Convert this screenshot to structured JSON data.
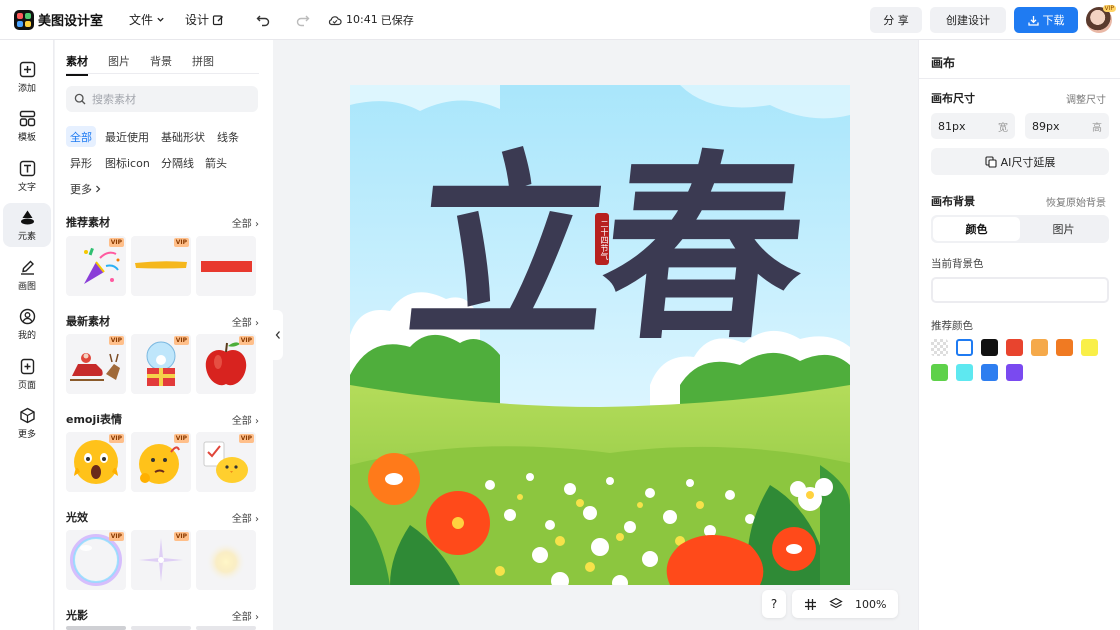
{
  "header": {
    "app_name": "美图设计室",
    "menu_file": "文件",
    "menu_design": "设计",
    "save_time": "10:41",
    "save_status": "已保存",
    "share": "分 享",
    "create_design": "创建设计",
    "download": "下载",
    "avatar_badge": "VIP"
  },
  "rail": [
    {
      "label": "添加",
      "icon": "plus-square-icon"
    },
    {
      "label": "模板",
      "icon": "template-grid-icon"
    },
    {
      "label": "文字",
      "icon": "text-icon"
    },
    {
      "label": "元素",
      "icon": "shapes-icon"
    },
    {
      "label": "画图",
      "icon": "draw-icon"
    },
    {
      "label": "我的",
      "icon": "user-icon"
    },
    {
      "label": "页面",
      "icon": "page-add-icon"
    },
    {
      "label": "更多",
      "icon": "cube-icon"
    }
  ],
  "panel": {
    "tabs": [
      "素材",
      "图片",
      "背景",
      "拼图"
    ],
    "search_placeholder": "搜索素材",
    "chips": [
      "全部",
      "最近使用",
      "基础形状",
      "线条",
      "异形",
      "图标icon",
      "分隔线",
      "箭头",
      "更多"
    ],
    "all_label": "全部",
    "vip": "VIP",
    "sections": [
      {
        "title": "推荐素材",
        "items": [
          "party-popper",
          "yellow-brush-stroke",
          "red-bar"
        ]
      },
      {
        "title": "最新素材",
        "items": [
          "santa-sleigh",
          "snow-globe-gift",
          "red-apple"
        ]
      },
      {
        "title": "emoji表情",
        "items": [
          "shocked-face",
          "thinking-face",
          "checklist-chick"
        ]
      },
      {
        "title": "光效",
        "items": [
          "bubble-ring",
          "star-sparkle",
          "soft-glow"
        ]
      },
      {
        "title": "光影",
        "items": []
      }
    ]
  },
  "canvas": {
    "title_text": "立春",
    "seal_text": "二十四节气",
    "colors": {
      "sky_top": "#bfeeff",
      "title": "#3b3a52",
      "grass": "#8cc63f",
      "flower": "#ff5a1f"
    }
  },
  "floatbar": {
    "help": "?",
    "zoom": "100%"
  },
  "right": {
    "title": "画布",
    "size_label": "画布尺寸",
    "adjust_size": "调整尺寸",
    "width_value": "81px",
    "width_unit": "宽",
    "height_value": "89px",
    "height_unit": "高",
    "ai_extend": "AI尺寸延展",
    "bg_label": "画布背景",
    "restore_bg": "恢复原始背景",
    "seg_color": "颜色",
    "seg_image": "图片",
    "current_bg": "当前背景色",
    "recommended": "推荐颜色",
    "swatches": [
      "transparent",
      "#ffffff",
      "#111111",
      "#e8442e",
      "#f5a94a",
      "#f07a22",
      "#f9ef48",
      "#5ed14a",
      "#5ee8f0",
      "#2e7ef0",
      "#7a4af0"
    ]
  }
}
